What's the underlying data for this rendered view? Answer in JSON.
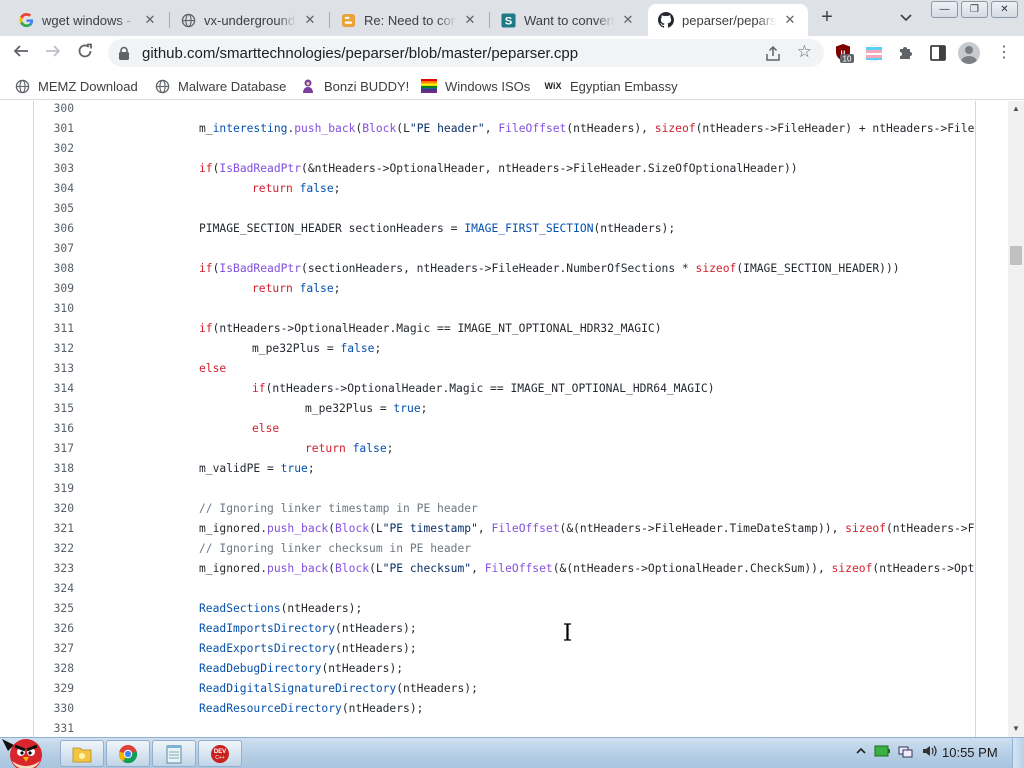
{
  "browser": {
    "tabs": [
      {
        "title": "wget windows -",
        "favicon": "google-g-icon",
        "active": false
      },
      {
        "title": "vx-underground",
        "favicon": "globe-icon",
        "active": false
      },
      {
        "title": "Re: Need to con",
        "favicon": "blogger-icon",
        "active": false
      },
      {
        "title": "Want to convert",
        "favicon": "scribd-s-icon",
        "active": false
      },
      {
        "title": "peparser/pepars",
        "favicon": "github-icon",
        "active": true
      }
    ],
    "new_tab_label": "+",
    "address_url": "github.com/smarttechnologies/peparser/blob/master/peparser.cpp",
    "extension_badge": "10",
    "bookmarks": [
      {
        "label": "MEMZ Download",
        "icon": "globe-icon"
      },
      {
        "label": "Malware Database",
        "icon": "globe-icon"
      },
      {
        "label": "Bonzi BUDDY!",
        "icon": "bonzi-icon"
      },
      {
        "label": "Windows ISOs",
        "icon": "rainbow-flag-icon"
      },
      {
        "label": "Egyptian Embassy",
        "icon": "wix-icon"
      }
    ]
  },
  "code": {
    "lines": [
      {
        "n": "300",
        "indent": 0,
        "tokens": []
      },
      {
        "n": "301",
        "indent": 1,
        "tokens": [
          [
            "id",
            "m_"
          ],
          [
            "fn2",
            "interesting"
          ],
          [
            "id",
            "."
          ],
          [
            "fn",
            "push_back"
          ],
          [
            "id",
            "("
          ],
          [
            "fn",
            "Block"
          ],
          [
            "id",
            "(L"
          ],
          [
            "str",
            "\"PE header\""
          ],
          [
            "id",
            ", "
          ],
          [
            "fn",
            "FileOffset"
          ],
          [
            "id",
            "(ntHeaders), "
          ],
          [
            "kw",
            "sizeof"
          ],
          [
            "id",
            "(ntHeaders->FileHeader) + ntHeaders->FileHeader.SizeOfOptionalHeader));"
          ]
        ]
      },
      {
        "n": "302",
        "indent": 0,
        "tokens": []
      },
      {
        "n": "303",
        "indent": 1,
        "tokens": [
          [
            "kw",
            "if"
          ],
          [
            "id",
            "("
          ],
          [
            "fn",
            "IsBadReadPtr"
          ],
          [
            "id",
            "(&ntHeaders->OptionalHeader, ntHeaders->FileHeader.SizeOfOptionalHeader))"
          ]
        ]
      },
      {
        "n": "304",
        "indent": 2,
        "tokens": [
          [
            "kw",
            "return"
          ],
          [
            "id",
            " "
          ],
          [
            "con",
            "false"
          ],
          [
            "id",
            ";"
          ]
        ]
      },
      {
        "n": "305",
        "indent": 0,
        "tokens": []
      },
      {
        "n": "306",
        "indent": 1,
        "tokens": [
          [
            "id",
            "PIMAGE_SECTION_HEADER sectionHeaders = "
          ],
          [
            "fn2",
            "IMAGE_FIRST_SECTION"
          ],
          [
            "id",
            "(ntHeaders);"
          ]
        ]
      },
      {
        "n": "307",
        "indent": 0,
        "tokens": []
      },
      {
        "n": "308",
        "indent": 1,
        "tokens": [
          [
            "kw",
            "if"
          ],
          [
            "id",
            "("
          ],
          [
            "fn",
            "IsBadReadPtr"
          ],
          [
            "id",
            "(sectionHeaders, ntHeaders->FileHeader.NumberOfSections * "
          ],
          [
            "kw",
            "sizeof"
          ],
          [
            "id",
            "(IMAGE_SECTION_HEADER)))"
          ]
        ]
      },
      {
        "n": "309",
        "indent": 2,
        "tokens": [
          [
            "kw",
            "return"
          ],
          [
            "id",
            " "
          ],
          [
            "con",
            "false"
          ],
          [
            "id",
            ";"
          ]
        ]
      },
      {
        "n": "310",
        "indent": 0,
        "tokens": []
      },
      {
        "n": "311",
        "indent": 1,
        "tokens": [
          [
            "kw",
            "if"
          ],
          [
            "id",
            "(ntHeaders->OptionalHeader.Magic == IMAGE_NT_OPTIONAL_HDR32_MAGIC)"
          ]
        ]
      },
      {
        "n": "312",
        "indent": 2,
        "tokens": [
          [
            "id",
            "m_pe32Plus = "
          ],
          [
            "con",
            "false"
          ],
          [
            "id",
            ";"
          ]
        ]
      },
      {
        "n": "313",
        "indent": 1,
        "tokens": [
          [
            "kw",
            "else"
          ]
        ]
      },
      {
        "n": "314",
        "indent": 2,
        "tokens": [
          [
            "kw",
            "if"
          ],
          [
            "id",
            "(ntHeaders->OptionalHeader.Magic == IMAGE_NT_OPTIONAL_HDR64_MAGIC)"
          ]
        ]
      },
      {
        "n": "315",
        "indent": 3,
        "tokens": [
          [
            "id",
            "m_pe32Plus = "
          ],
          [
            "con",
            "true"
          ],
          [
            "id",
            ";"
          ]
        ]
      },
      {
        "n": "316",
        "indent": 2,
        "tokens": [
          [
            "kw",
            "else"
          ]
        ]
      },
      {
        "n": "317",
        "indent": 3,
        "tokens": [
          [
            "kw",
            "return"
          ],
          [
            "id",
            " "
          ],
          [
            "con",
            "false"
          ],
          [
            "id",
            ";"
          ]
        ]
      },
      {
        "n": "318",
        "indent": 1,
        "tokens": [
          [
            "id",
            "m_validPE = "
          ],
          [
            "con",
            "true"
          ],
          [
            "id",
            ";"
          ]
        ]
      },
      {
        "n": "319",
        "indent": 0,
        "tokens": []
      },
      {
        "n": "320",
        "indent": 1,
        "tokens": [
          [
            "com",
            "// Ignoring linker timestamp in PE header"
          ]
        ]
      },
      {
        "n": "321",
        "indent": 1,
        "tokens": [
          [
            "id",
            "m_ignored."
          ],
          [
            "fn",
            "push_back"
          ],
          [
            "id",
            "("
          ],
          [
            "fn",
            "Block"
          ],
          [
            "id",
            "(L"
          ],
          [
            "str",
            "\"PE timestamp\""
          ],
          [
            "id",
            ", "
          ],
          [
            "fn",
            "FileOffset"
          ],
          [
            "id",
            "(&(ntHeaders->FileHeader.TimeDateStamp)), "
          ],
          [
            "kw",
            "sizeof"
          ],
          [
            "id",
            "(ntHeaders->FileHeader.TimeDateStamp)));"
          ]
        ]
      },
      {
        "n": "322",
        "indent": 1,
        "tokens": [
          [
            "com",
            "// Ignoring linker checksum in PE header"
          ]
        ]
      },
      {
        "n": "323",
        "indent": 1,
        "tokens": [
          [
            "id",
            "m_ignored."
          ],
          [
            "fn",
            "push_back"
          ],
          [
            "id",
            "("
          ],
          [
            "fn",
            "Block"
          ],
          [
            "id",
            "(L"
          ],
          [
            "str",
            "\"PE checksum\""
          ],
          [
            "id",
            ", "
          ],
          [
            "fn",
            "FileOffset"
          ],
          [
            "id",
            "(&(ntHeaders->OptionalHeader.CheckSum)), "
          ],
          [
            "kw",
            "sizeof"
          ],
          [
            "id",
            "(ntHeaders->OptionalHeader.CheckSum)));"
          ]
        ]
      },
      {
        "n": "324",
        "indent": 0,
        "tokens": []
      },
      {
        "n": "325",
        "indent": 1,
        "tokens": [
          [
            "fn2",
            "ReadSections"
          ],
          [
            "id",
            "(ntHeaders);"
          ]
        ]
      },
      {
        "n": "326",
        "indent": 1,
        "tokens": [
          [
            "fn2",
            "ReadImportsDirectory"
          ],
          [
            "id",
            "(ntHeaders);"
          ]
        ]
      },
      {
        "n": "327",
        "indent": 1,
        "tokens": [
          [
            "fn2",
            "ReadExportsDirectory"
          ],
          [
            "id",
            "(ntHeaders);"
          ]
        ]
      },
      {
        "n": "328",
        "indent": 1,
        "tokens": [
          [
            "fn2",
            "ReadDebugDirectory"
          ],
          [
            "id",
            "(ntHeaders);"
          ]
        ]
      },
      {
        "n": "329",
        "indent": 1,
        "tokens": [
          [
            "fn2",
            "ReadDigitalSignatureDirectory"
          ],
          [
            "id",
            "(ntHeaders);"
          ]
        ]
      },
      {
        "n": "330",
        "indent": 1,
        "tokens": [
          [
            "fn2",
            "ReadResourceDirectory"
          ],
          [
            "id",
            "(ntHeaders);"
          ]
        ]
      },
      {
        "n": "331",
        "indent": 0,
        "tokens": []
      }
    ]
  },
  "taskbar": {
    "clock": "10:55 PM",
    "apps": [
      "explorer-folder-icon",
      "chrome-icon",
      "notepad-icon",
      "devcpp-icon"
    ]
  },
  "colors": {
    "keyword": "#cf222e",
    "function": "#8250df",
    "string": "#0a3069",
    "comment": "#6e7781"
  }
}
